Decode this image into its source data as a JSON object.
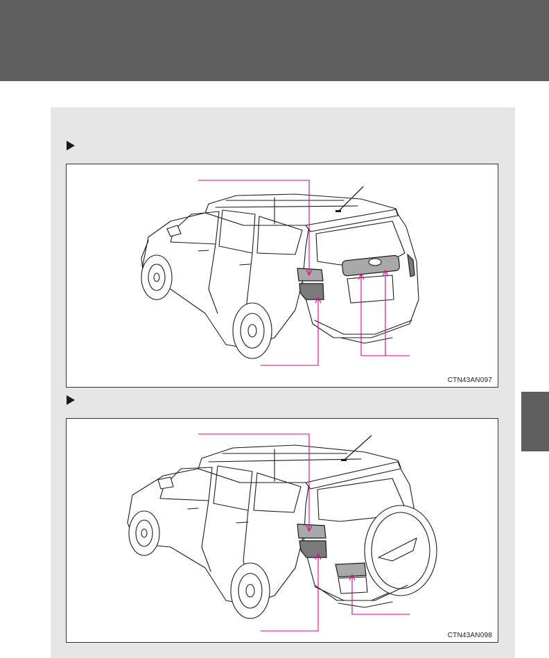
{
  "figures": [
    {
      "code": "CTN43AN097"
    },
    {
      "code": "CTN43AN098"
    }
  ],
  "colors": {
    "header": "#5e5e5e",
    "panel": "#e6e6e6",
    "leader_line": "#e0009a"
  },
  "icons": [
    "play-triangle-icon",
    "play-triangle-icon"
  ]
}
